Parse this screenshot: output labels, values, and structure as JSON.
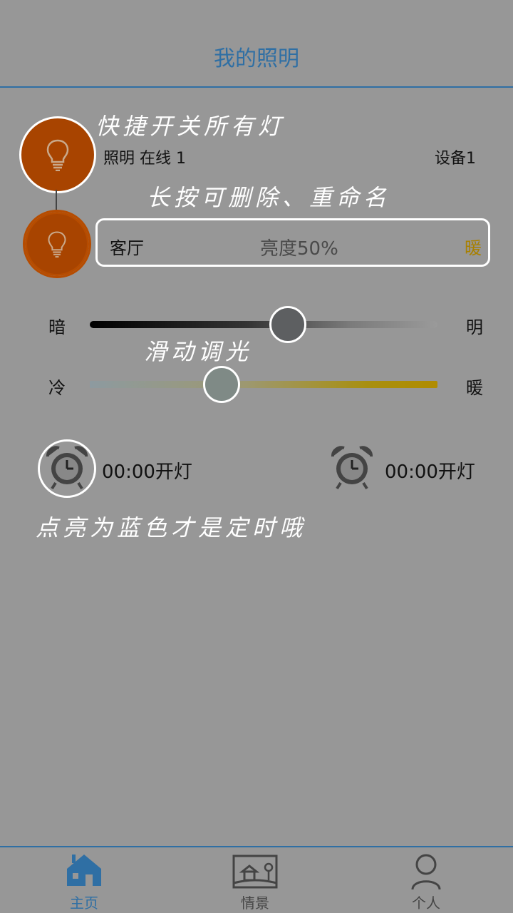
{
  "header": {
    "title": "我的照明"
  },
  "tips": {
    "quick_switch": "快捷开关所有灯",
    "long_press": "长按可删除、重命名",
    "slide": "滑动调光",
    "timer": "点亮为蓝色才是定时哦"
  },
  "group": {
    "name_status": "照明 在线 1",
    "device": "设备1"
  },
  "room": {
    "name": "客厅",
    "brightness": "亮度50%",
    "warmth": "暖"
  },
  "sliders": {
    "brightness": {
      "left": "暗",
      "right": "明",
      "value_fraction": 0.57
    },
    "temperature": {
      "left": "冷",
      "right": "暖",
      "value_fraction": 0.38
    }
  },
  "timers": [
    {
      "label": "00:00开灯",
      "active": false
    },
    {
      "label": "00:00开灯",
      "active": false
    }
  ],
  "tabbar": {
    "items": [
      {
        "label": "主页",
        "icon": "home-icon",
        "active": true
      },
      {
        "label": "情景",
        "icon": "scene-icon",
        "active": false
      },
      {
        "label": "个人",
        "icon": "person-icon",
        "active": false
      }
    ]
  },
  "colors": {
    "background": "#979797",
    "accent": "#2f6fa4",
    "bulb": "#a84400",
    "warm": "#a88000"
  }
}
